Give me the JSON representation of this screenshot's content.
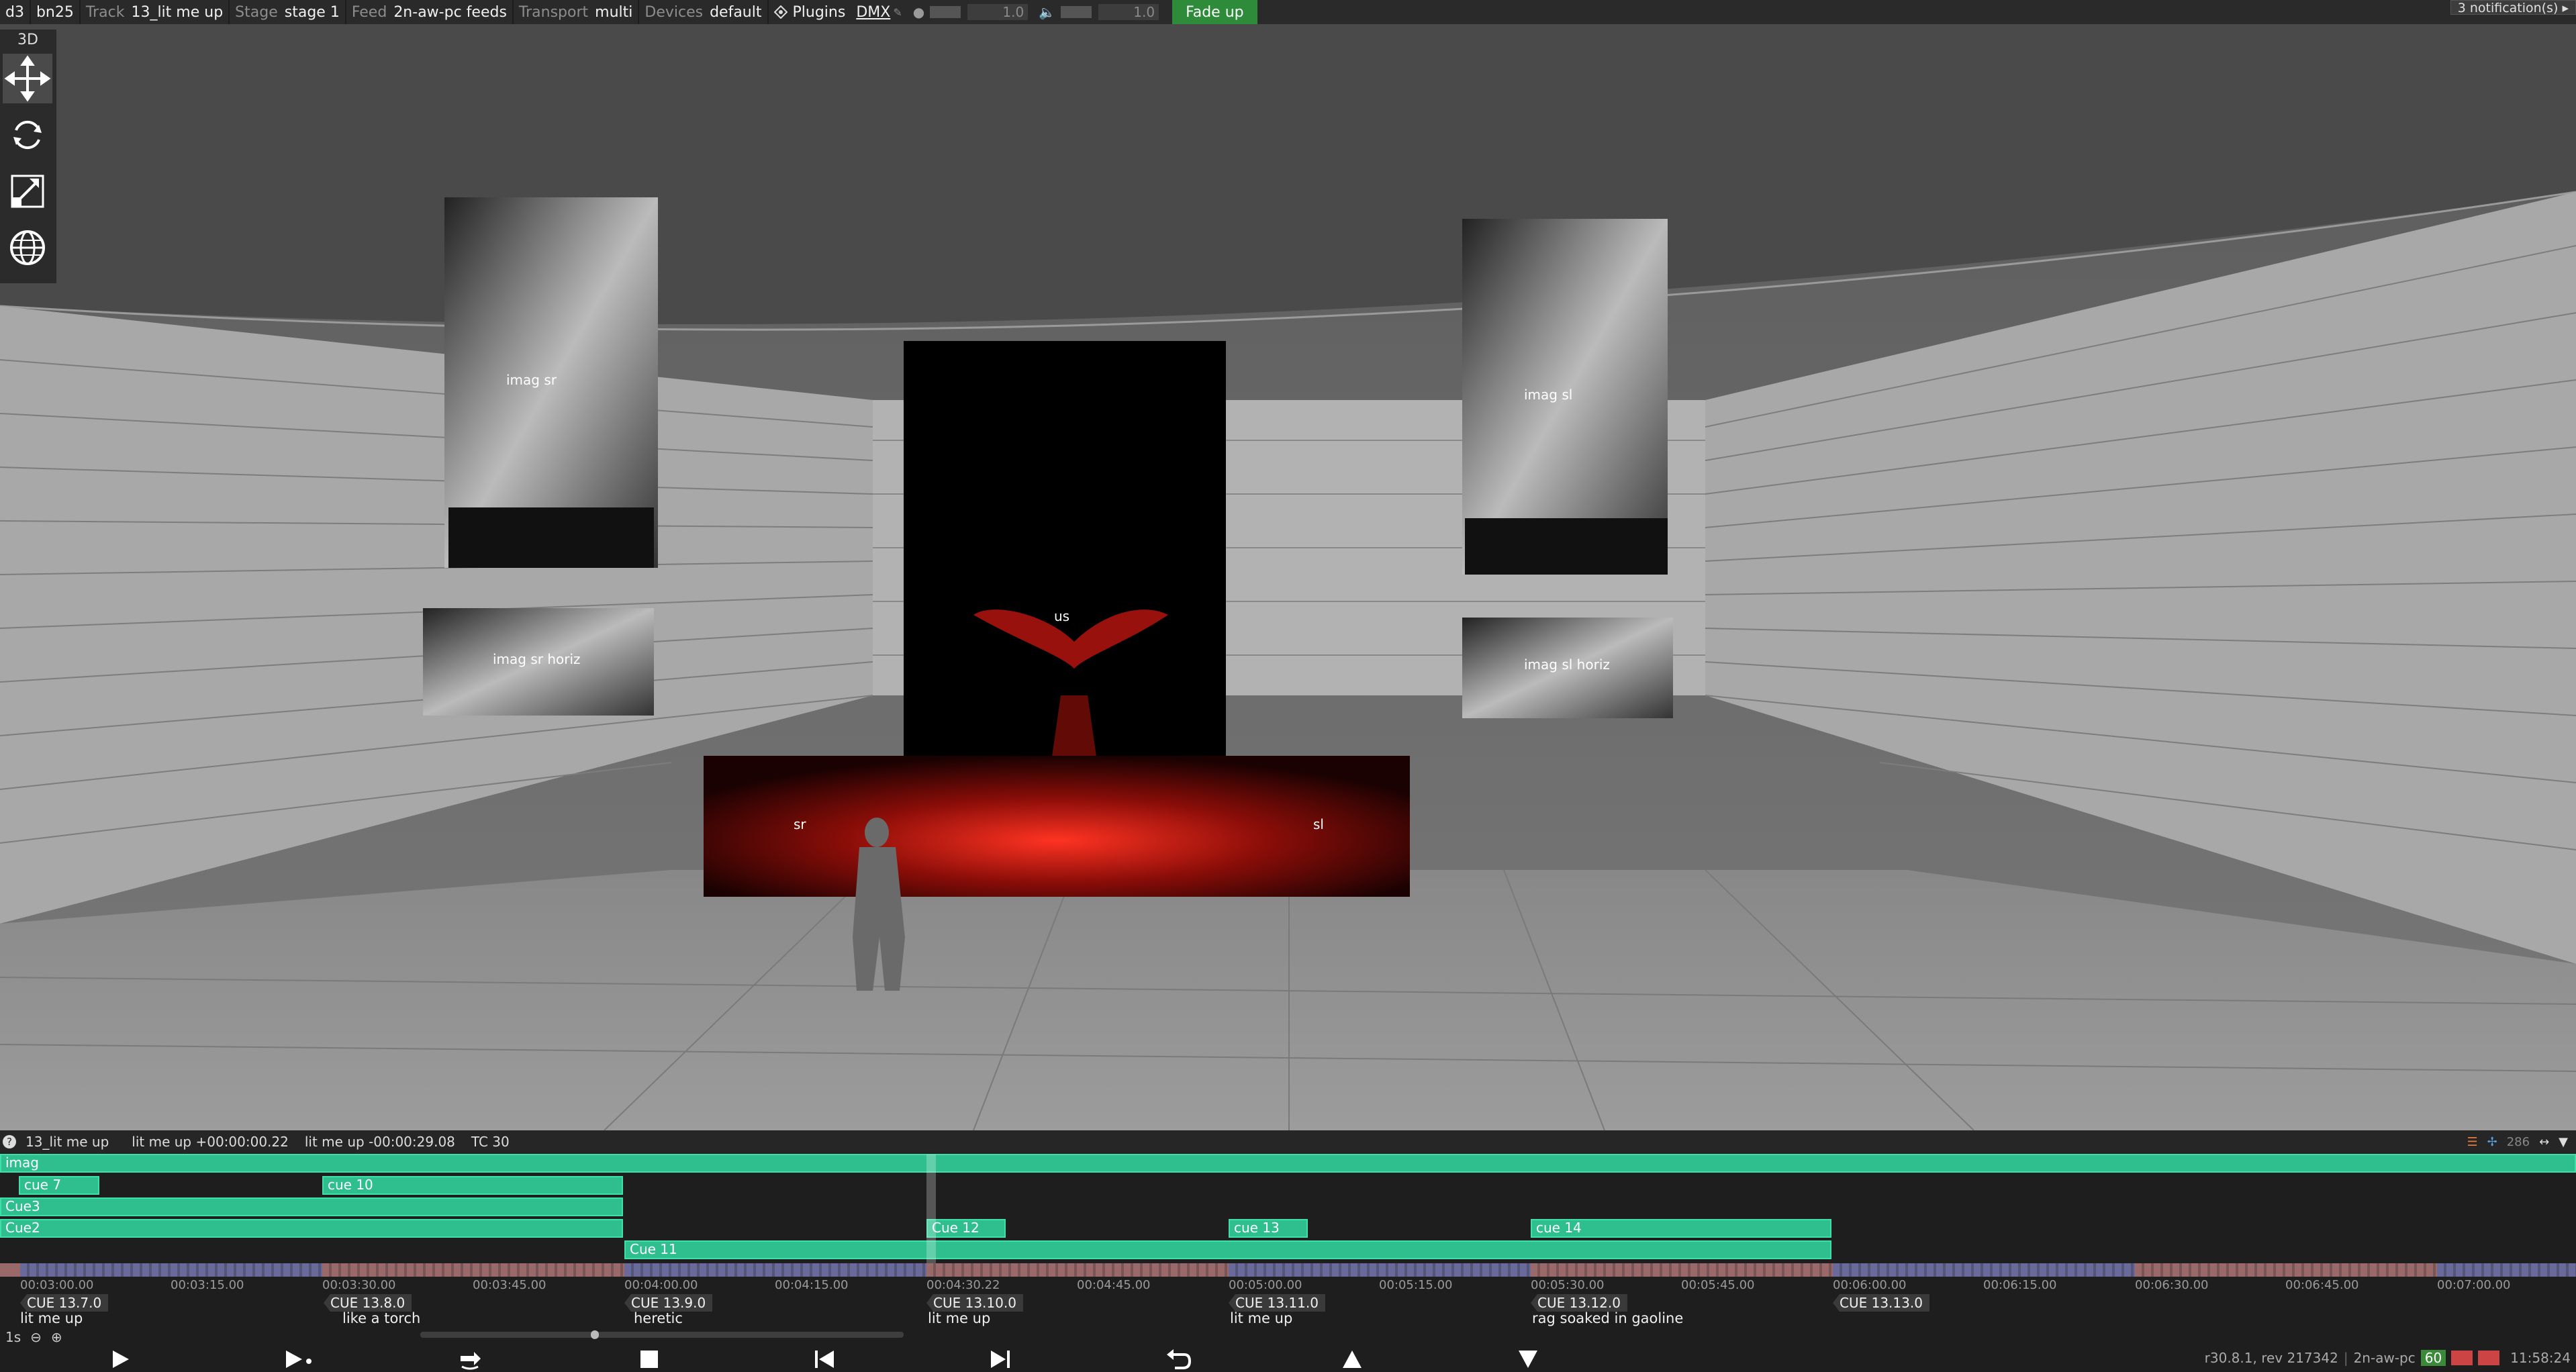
{
  "topbar": {
    "app": "d3",
    "project": "bn25",
    "track_label": "Track",
    "track_value": "13_lit me up",
    "stage_label": "Stage",
    "stage_value": "stage 1",
    "feed_label": "Feed",
    "feed_value": "2n-aw-pc feeds",
    "transport_label": "Transport",
    "transport_value": "multi",
    "devices_label": "Devices",
    "devices_value": "default",
    "plugins_label": "Plugins",
    "dmx_label": "DMX",
    "brightness_value": "1.0",
    "volume_value": "1.0",
    "fade_up_label": "Fade up",
    "notifications": "3 notification(s)"
  },
  "tools": {
    "title": "3D"
  },
  "viewport": {
    "labels": {
      "imag_sr": "imag sr",
      "imag_sl": "imag sl",
      "imag_sr_horiz": "imag sr horiz",
      "imag_sl_horiz": "imag sl horiz",
      "us": "us",
      "sr": "sr",
      "sl": "sl"
    }
  },
  "timeline": {
    "header": {
      "track": "13_lit me up",
      "position": "lit me up +00:00:00.22",
      "remaining": "lit me up -00:00:29.08",
      "tc": "TC 30",
      "right_value": "286"
    },
    "layers": [
      {
        "name": "imag"
      },
      {
        "name": "cue 7"
      },
      {
        "name": "cue 10"
      },
      {
        "name": "Cue3"
      },
      {
        "name": "Cue2"
      },
      {
        "name": "Cue 12"
      },
      {
        "name": "cue 13"
      },
      {
        "name": "cue 14"
      },
      {
        "name": "Cue 11"
      }
    ],
    "ticks": [
      "00:03:00.00",
      "00:03:15.00",
      "00:03:30.00",
      "00:03:45.00",
      "00:04:00.00",
      "00:04:15.00",
      "00:04:30.22",
      "00:04:45.00",
      "00:05:00.00",
      "00:05:15.00",
      "00:05:30.00",
      "00:05:45.00",
      "00:06:00.00",
      "00:06:15.00",
      "00:06:30.00",
      "00:06:45.00",
      "00:07:00.00"
    ],
    "cues": [
      {
        "tag": "CUE 13.7.0",
        "name": "lit me up"
      },
      {
        "tag": "CUE 13.8.0",
        "name": "like a torch"
      },
      {
        "tag": "CUE 13.9.0",
        "name": "heretic"
      },
      {
        "tag": "CUE 13.10.0",
        "name": "lit me up"
      },
      {
        "tag": "CUE 13.11.0",
        "name": "lit me up"
      },
      {
        "tag": "CUE 13.12.0",
        "name": "rag soaked in gaoline"
      },
      {
        "tag": "CUE 13.13.0",
        "name": ""
      }
    ],
    "zoom_label": "1s",
    "status": {
      "version": "r30.8.1, rev 217342",
      "machine": "2n-aw-pc",
      "fps": "60",
      "clock": "11:58:24"
    }
  },
  "colors": {
    "layer_green": "#2fbf8f",
    "fade_up": "#2e8b3a",
    "ruler_blue": "#6a6a9a",
    "ruler_red": "#9a6a6a"
  }
}
